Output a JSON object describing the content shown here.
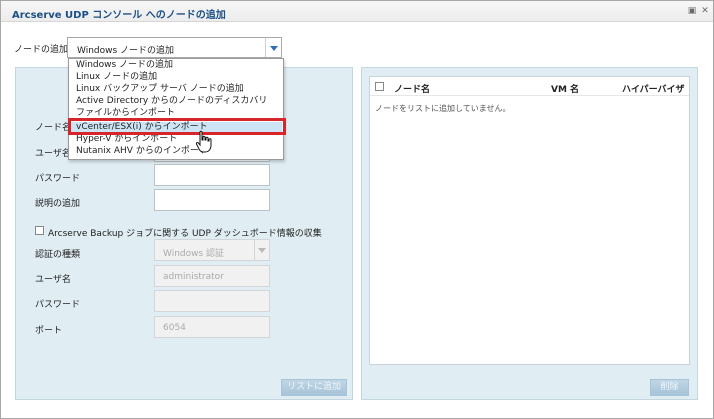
{
  "window": {
    "title": "Arcserve UDP コンソール へのノードの追加",
    "restore_icon": "restore-icon",
    "close_icon": "close-icon"
  },
  "add_node": {
    "label": "ノードの追加",
    "selected": "Windows ノードの追加"
  },
  "dropdown_options": [
    "Windows ノードの追加",
    "Linux ノードの追加",
    "Linux バックアップ サーバ ノードの追加",
    "Active Directory からのノードのディスカバリ",
    "ファイルからインポート",
    "vCenter/ESX(i) からインポート",
    "Hyper-V からインポート",
    "Nutanix AHV からのインポート"
  ],
  "form": {
    "node_name_label": "ノード名",
    "user_name_label": "ユーザ名",
    "password_label": "パスワード",
    "description_label": "説明の追加",
    "collect_checkbox_label": "Arcserve Backup ジョブに関する UDP ダッシュボード情報の収集",
    "auth_type_label": "認証の種類",
    "auth_type_value": "Windows 認証",
    "user_name2_label": "ユーザ名",
    "user_name2_value": "administrator",
    "password2_label": "パスワード",
    "port_label": "ポート",
    "port_value": "6054",
    "add_to_list_button": "リストに追加"
  },
  "node_list": {
    "col_node_name": "ノード名",
    "col_vm_name": "VM 名",
    "col_hypervisor": "ハイパーバイザ",
    "empty_message": "ノードをリストに追加していません。",
    "delete_button": "削除"
  },
  "colors": {
    "title": "#1b4f87",
    "panel": "#e0edf3",
    "highlight_border": "#d8242b",
    "dropdown_arrow": "#2f70b5"
  }
}
